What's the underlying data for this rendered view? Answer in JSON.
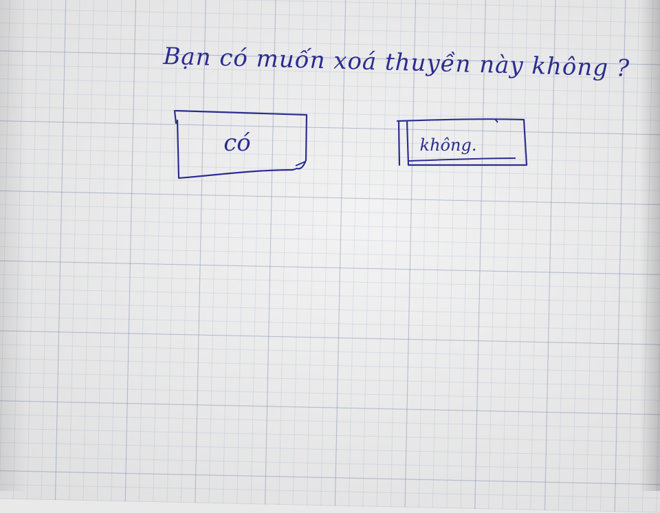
{
  "dialog": {
    "question": "Bạn có muốn xoá thuyền này không ?",
    "buttons": {
      "yes_label": "có",
      "no_label": "không."
    }
  },
  "colors": {
    "ink": "#2b2d8f",
    "paper": "#ececed",
    "grid_line": "#6a84b0"
  }
}
